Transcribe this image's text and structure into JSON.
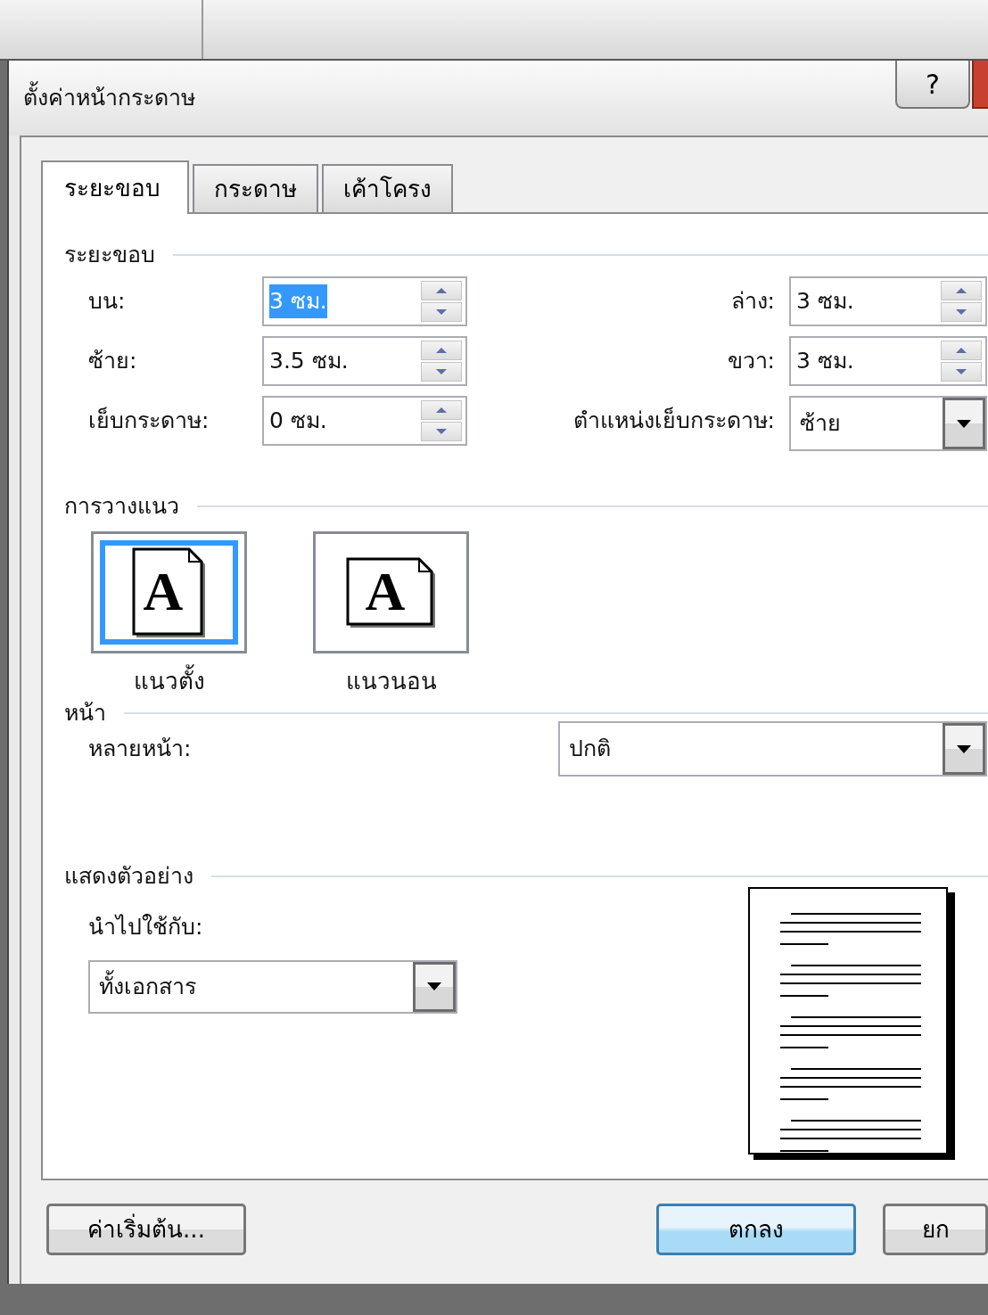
{
  "window": {
    "title": "ตั้งค่าหน้ากระดาษ",
    "help_button": "?"
  },
  "tabs": [
    {
      "label": "ระยะขอบ",
      "selected": true
    },
    {
      "label": "กระดาษ",
      "selected": false
    },
    {
      "label": "เค้าโครง",
      "selected": false
    }
  ],
  "margins": {
    "heading": "ระยะขอบ",
    "fields": [
      {
        "label": "บน:",
        "value": "3 ซม.",
        "kind": "spin",
        "selected": true
      },
      {
        "label": "ล่าง:",
        "value": "3 ซม.",
        "kind": "spin",
        "selected": false
      },
      {
        "label": "ซ้าย:",
        "value": "3.5 ซม.",
        "kind": "spin",
        "selected": false
      },
      {
        "label": "ขวา:",
        "value": "3 ซม.",
        "kind": "spin",
        "selected": false
      },
      {
        "label": "เย็บกระดาษ:",
        "value": "0 ซม.",
        "kind": "spin",
        "selected": false
      },
      {
        "label": "ตำแหน่งเย็บกระดาษ:",
        "value": "ซ้าย",
        "kind": "dropdown",
        "selected": false
      }
    ]
  },
  "orientation": {
    "heading": "การวางแนว",
    "options": [
      {
        "label": "แนวตั้ง",
        "kind": "portrait",
        "icon_text": "A",
        "selected": true
      },
      {
        "label": "แนวนอน",
        "kind": "landscape",
        "icon_text": "A",
        "selected": false
      }
    ]
  },
  "pages": {
    "heading": "หน้า",
    "multiple_pages": {
      "label": "หลายหน้า:",
      "value": "ปกติ"
    }
  },
  "preview": {
    "heading": "แสดงตัวอย่าง",
    "apply_to": {
      "label": "นำไปใช้กับ:",
      "value": "ทั้งเอกสาร"
    }
  },
  "buttons": [
    {
      "label": "ค่าเริ่มต้น...",
      "kind": "default"
    },
    {
      "label": "ตกลง",
      "kind": "primary"
    },
    {
      "label": "ยก",
      "kind": "default"
    }
  ]
}
